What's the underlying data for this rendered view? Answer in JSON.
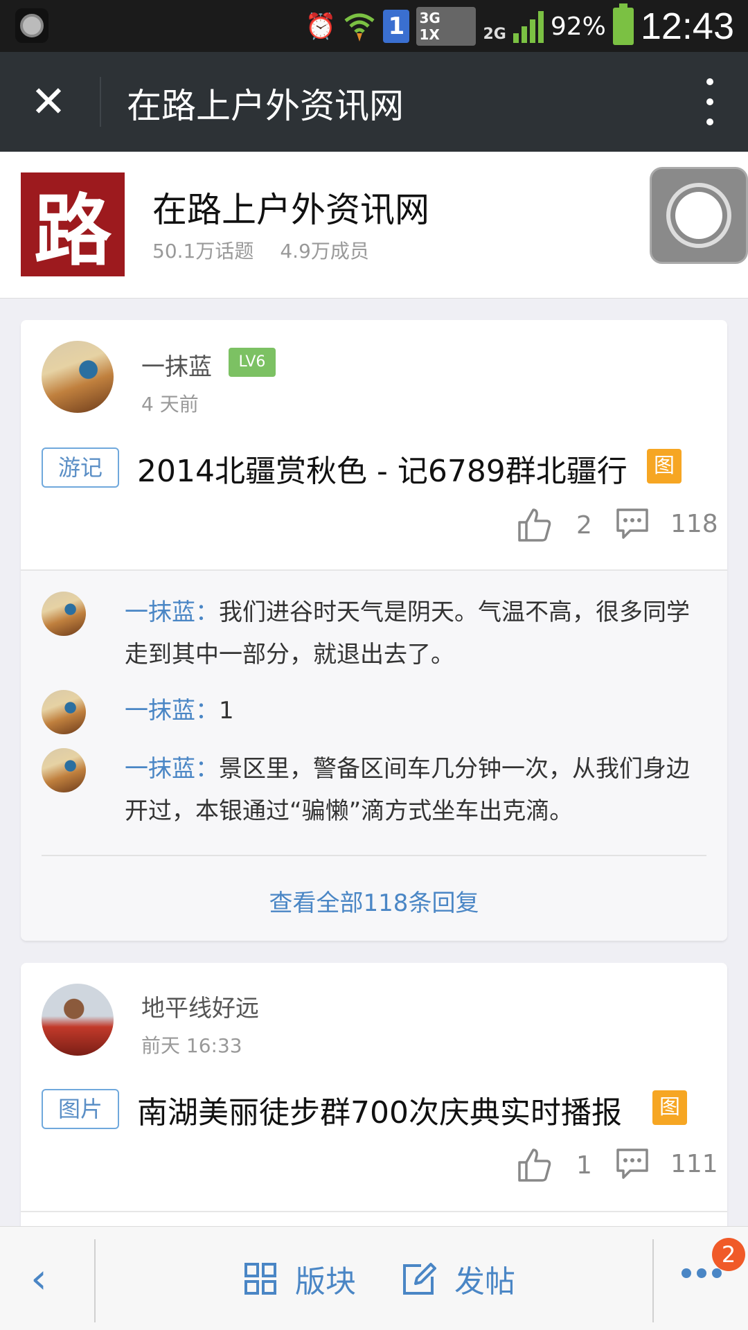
{
  "status_bar": {
    "battery_percent": "92%",
    "time": "12:43",
    "network_3g": "3G",
    "network_1x": "1X",
    "network_2g": "2G",
    "sim_slot": "1"
  },
  "title_bar": {
    "title": "在路上户外资讯网",
    "close_icon": "close-icon",
    "more_icon": "more-vertical-icon"
  },
  "forum": {
    "logo_char": "路",
    "name": "在路上户外资讯网",
    "topics": "50.1万话题",
    "members": "4.9万成员"
  },
  "posts": [
    {
      "author": "一抹蓝",
      "level": "LV6",
      "time": "4 天前",
      "tag": "游记",
      "title": "2014北疆赏秋色 - 记6789群北疆行",
      "image_badge": "图",
      "likes": "2",
      "comments": "118",
      "replies": [
        {
          "name": "一抹蓝：",
          "text": "我们进谷时天气是阴天。气温不高，很多同学走到其中一部分，就退出去了。"
        },
        {
          "name": "一抹蓝：",
          "text": "1"
        },
        {
          "name": "一抹蓝：",
          "text": "景区里，警备区间车几分钟一次，从我们身边开过，本银通过“骗懒”滴方式坐车出克滴。"
        }
      ],
      "view_all": "查看全部118条回复"
    },
    {
      "author": "地平线好远",
      "time": "前天 16:33",
      "tag": "图片",
      "title": "南湖美丽徒步群700次庆典实时播报",
      "image_badge": "图",
      "likes": "1",
      "comments": "111"
    }
  ],
  "bottom_bar": {
    "sections_label": "版块",
    "post_label": "发帖",
    "notification_count": "2"
  },
  "colors": {
    "accent": "#4a86c5",
    "title_bar": "#2d3236",
    "level_badge": "#7cc163",
    "image_badge": "#f6a623",
    "notification": "#f05a28"
  }
}
